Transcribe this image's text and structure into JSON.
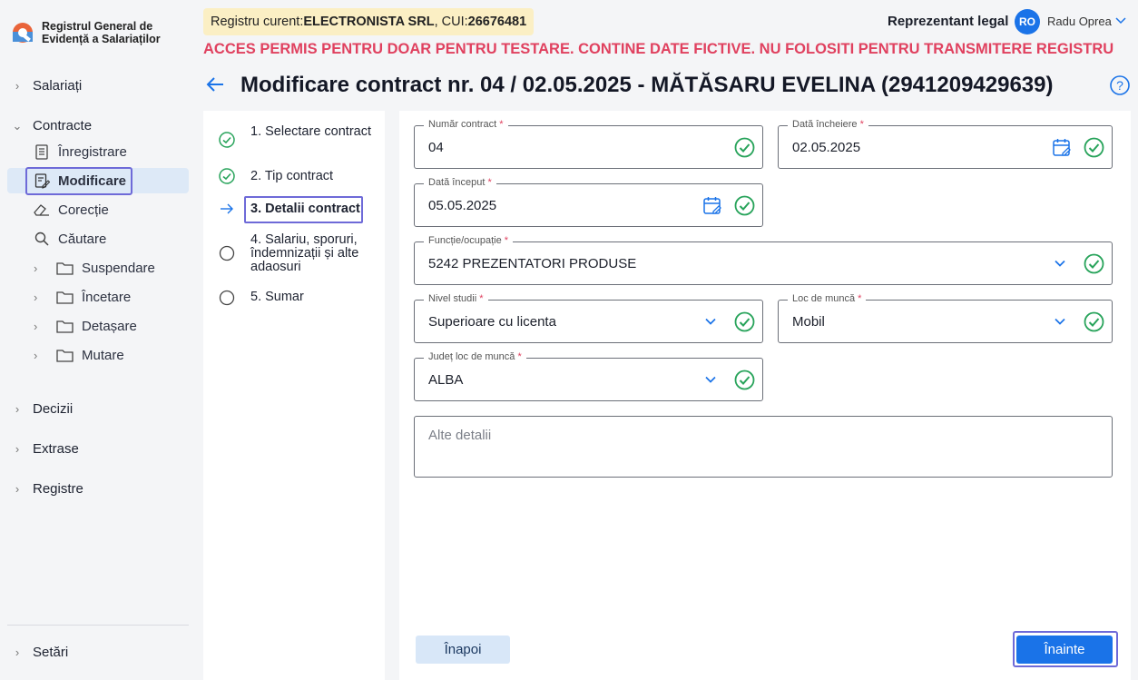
{
  "app": {
    "logo_line1": "Registrul General de",
    "logo_line2": "Evidență a Salariaților"
  },
  "sidebar": {
    "salariati": "Salariați",
    "contracte": "Contracte",
    "contracte_items": [
      {
        "label": "Înregistrare",
        "icon": "register-icon"
      },
      {
        "label": "Modificare",
        "icon": "edit-doc-icon"
      },
      {
        "label": "Corecție",
        "icon": "eraser-icon"
      },
      {
        "label": "Căutare",
        "icon": "search-icon"
      }
    ],
    "folders": [
      "Suspendare",
      "Încetare",
      "Detașare",
      "Mutare"
    ],
    "decizii": "Decizii",
    "extrase": "Extrase",
    "registre": "Registre",
    "setari": "Setări"
  },
  "header": {
    "registry_prefix": "Registru curent: ",
    "registry_company": "ELECTRONISTA SRL",
    "registry_cui_label": ", CUI: ",
    "registry_cui": "26676481",
    "rep_legal": "Reprezentant legal",
    "avatar_initials": "RO",
    "user_name": "Radu Oprea",
    "warning": "ACCES PERMIS PENTRU DOAR PENTRU TESTARE. CONTINE DATE FICTIVE. NU FOLOSITI PENTRU TRANSMITERE REGISTRU"
  },
  "page": {
    "title": "Modificare contract nr. 04 / 02.05.2025 - MĂTĂSARU  EVELINA (2941209429639)"
  },
  "steps": [
    {
      "label": "1. Selectare contract",
      "state": "done"
    },
    {
      "label": "2. Tip contract",
      "state": "done"
    },
    {
      "label": "3. Detalii contract",
      "state": "current"
    },
    {
      "label": "4. Salariu, sporuri, îndemnizații și alte adaosuri",
      "state": "todo"
    },
    {
      "label": "5. Sumar",
      "state": "todo"
    }
  ],
  "form": {
    "numar_contract": {
      "label": "Număr contract",
      "value": "04"
    },
    "data_incheiere": {
      "label": "Dată încheiere",
      "value": "02.05.2025"
    },
    "data_inceput": {
      "label": "Dată început",
      "value": "05.05.2025"
    },
    "functie": {
      "label": "Funcție/ocupație",
      "value": "5242 PREZENTATORI PRODUSE"
    },
    "nivel_studii": {
      "label": "Nivel studii",
      "value": "Superioare cu licenta"
    },
    "loc_munca": {
      "label": "Loc de muncă",
      "value": "Mobil"
    },
    "judet": {
      "label": "Județ loc de muncă",
      "value": "ALBA"
    },
    "alte_detalii_placeholder": "Alte detalii",
    "required_mark": "*",
    "back_label": "Înapoi",
    "next_label": "Înainte"
  },
  "colors": {
    "accent": "#1a73e8",
    "success": "#27a35a",
    "warning": "#e0415f",
    "focus": "#6e6ad8"
  }
}
